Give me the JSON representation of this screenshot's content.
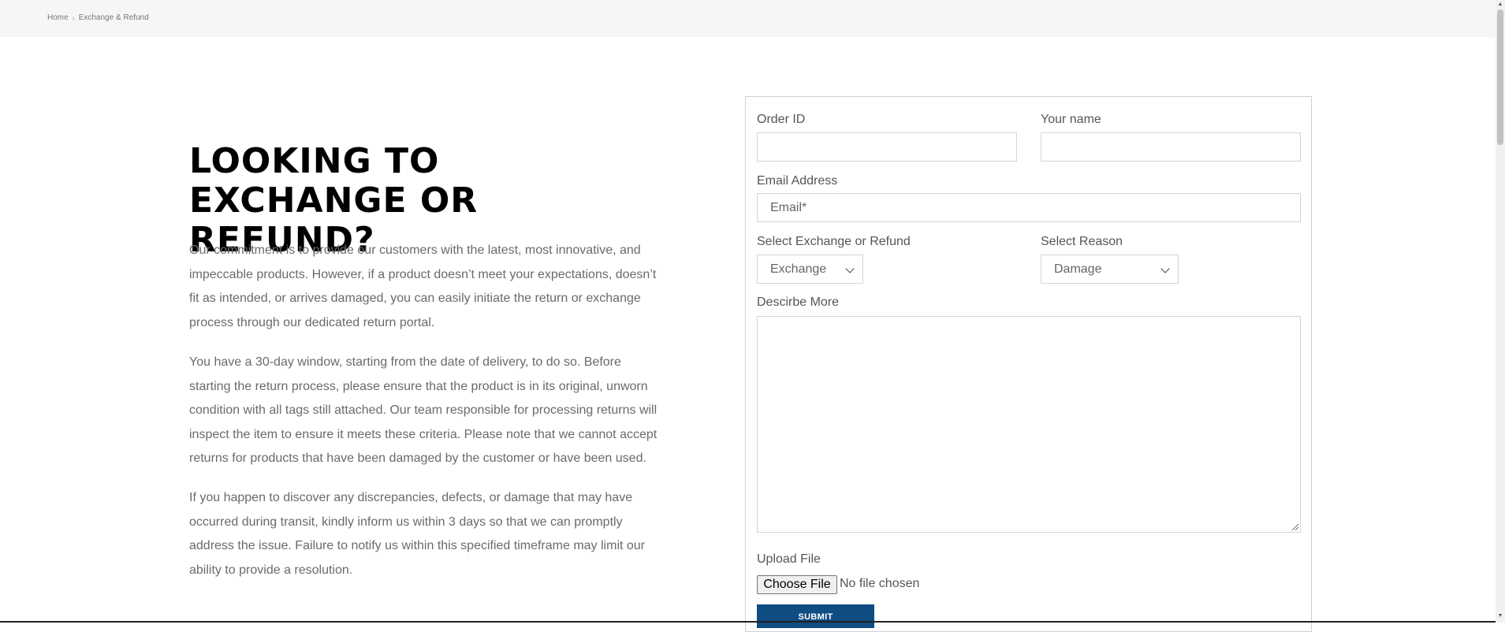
{
  "breadcrumb": {
    "home": "Home",
    "separator": "›",
    "current": "Exchange & Refund"
  },
  "heading": "LOOKING TO EXCHANGE OR REFUND?",
  "paragraphs": [
    "Our commitment is to provide our customers with the latest, most innovative, and impeccable products. However, if a product doesn’t meet your expectations, doesn’t fit as intended, or arrives damaged, you can easily initiate the return or exchange process through our dedicated return portal.",
    "You have a 30-day window, starting from the date of delivery, to do so. Before starting the return process, please ensure that the product is in its original, unworn condition with all tags still attached. Our team responsible for processing returns will inspect the item to ensure it meets these criteria. Please note that we cannot accept returns for products that have been damaged by the customer or have been used.",
    "If you happen to discover any discrepancies, defects, or damage that may have occurred during transit, kindly inform us within 3 days so that we can promptly address the issue. Failure to notify us within this specified timeframe may limit our ability to provide a resolution."
  ],
  "form": {
    "order_id_label": "Order ID",
    "order_id_value": "",
    "name_label": "Your name",
    "name_value": "",
    "email_label": "Email Address",
    "email_placeholder": "Email*",
    "type_label": "Select Exchange or Refund",
    "type_selected": "Exchange",
    "reason_label": "Select Reason",
    "reason_selected": "Damage",
    "describe_label": "Descirbe More",
    "upload_label": "Upload File",
    "choose_file": "Choose File",
    "file_status": "No file chosen",
    "submit": "SUBMIT"
  },
  "colors": {
    "submit_bg": "#0f4c81",
    "heading": "#000000",
    "body_text": "#6a6a6a",
    "topbar_bg": "#f6f6f7"
  }
}
